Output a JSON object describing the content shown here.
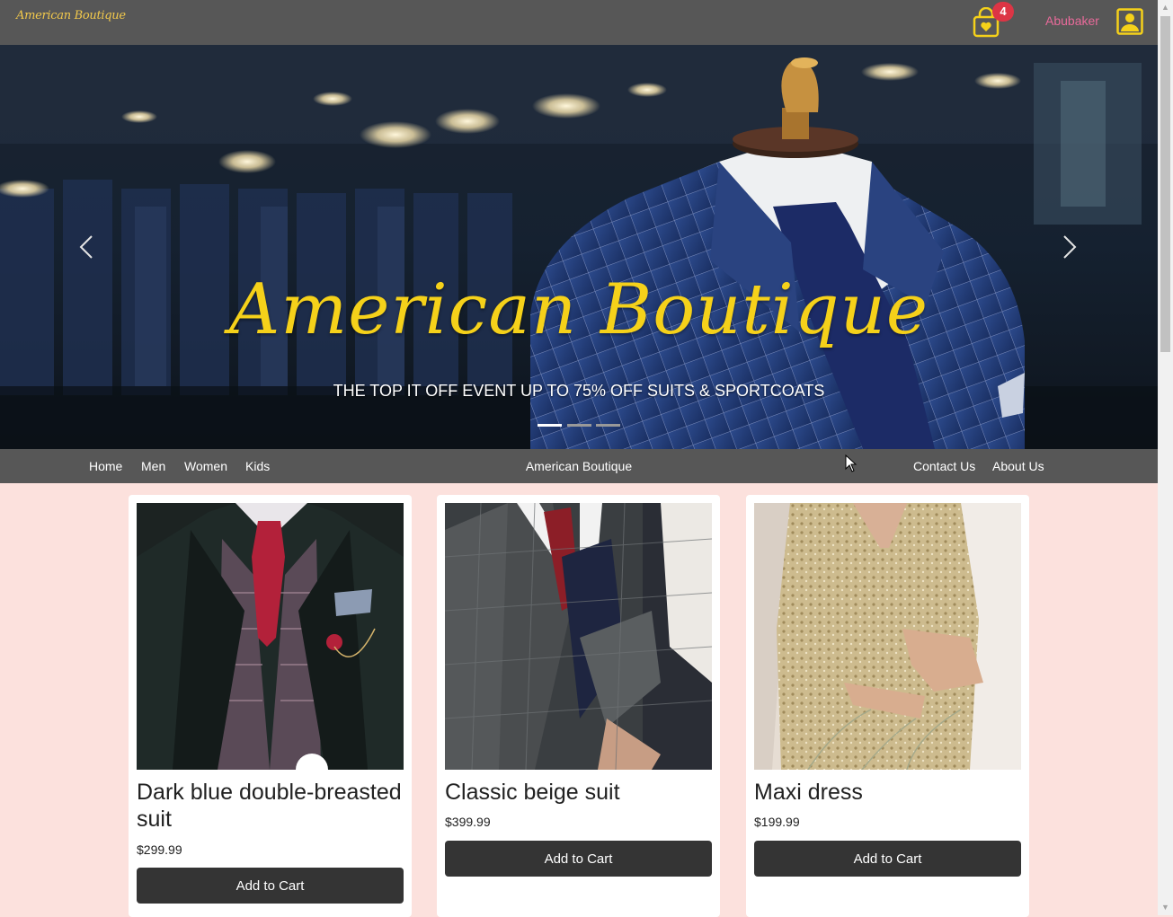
{
  "header": {
    "logo_text": "American Boutique",
    "cart_icon": "shopping-bag-heart-icon",
    "cart_count": "4",
    "username": "Abubaker",
    "user_icon": "user-profile-icon",
    "accent_color": "#f5d11a",
    "badge_color": "#dc3545",
    "username_color": "#e86a9a"
  },
  "hero": {
    "title": "American Boutique",
    "subtitle": "THE TOP IT OFF EVENT UP TO 75% OFF SUITS & SPORTCOATS",
    "prev_icon": "chevron-left-icon",
    "next_icon": "chevron-right-icon",
    "slide_count": 3,
    "active_slide": 1
  },
  "nav": {
    "left_links": [
      "Home",
      "Men",
      "Women",
      "Kids"
    ],
    "brand": "American Boutique",
    "right_links": [
      "Contact Us",
      "About Us"
    ]
  },
  "products": [
    {
      "name": "Dark blue double-breasted suit",
      "price": "$299.99",
      "button": "Add to Cart"
    },
    {
      "name": "Classic beige suit",
      "price": "$399.99",
      "button": "Add to Cart"
    },
    {
      "name": "Maxi dress",
      "price": "$199.99",
      "button": "Add to Cart"
    }
  ]
}
